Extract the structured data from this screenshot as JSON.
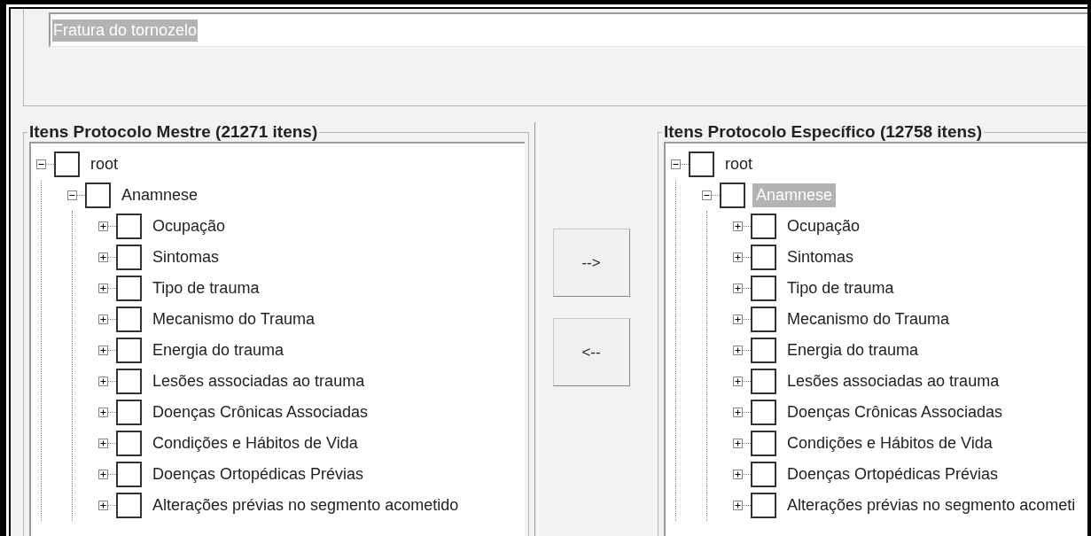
{
  "name_field": {
    "value": "Fratura do tornozelo",
    "text_selected": true
  },
  "left_panel": {
    "title": "Itens Protocolo Mestre (21271 itens)",
    "tree": [
      {
        "label": "root",
        "expanded": true,
        "checked": false,
        "selected": false,
        "children": [
          {
            "label": "Anamnese",
            "expanded": true,
            "checked": false,
            "selected": false,
            "children": [
              {
                "label": "Ocupação",
                "expanded": false,
                "checked": false,
                "selected": false
              },
              {
                "label": "Sintomas",
                "expanded": false,
                "checked": false,
                "selected": false
              },
              {
                "label": "Tipo de trauma",
                "expanded": false,
                "checked": false,
                "selected": false
              },
              {
                "label": "Mecanismo do Trauma",
                "expanded": false,
                "checked": false,
                "selected": false
              },
              {
                "label": "Energia do trauma",
                "expanded": false,
                "checked": false,
                "selected": false
              },
              {
                "label": "Lesões associadas ao trauma",
                "expanded": false,
                "checked": false,
                "selected": false
              },
              {
                "label": "Doenças Crônicas Associadas",
                "expanded": false,
                "checked": false,
                "selected": false
              },
              {
                "label": "Condições e Hábitos de Vida",
                "expanded": false,
                "checked": false,
                "selected": false
              },
              {
                "label": "Doenças Ortopédicas Prévias",
                "expanded": false,
                "checked": false,
                "selected": false
              },
              {
                "label": "Alterações prévias no segmento acometido",
                "expanded": false,
                "checked": false,
                "selected": false
              }
            ]
          }
        ]
      }
    ]
  },
  "buttons": [
    {
      "label": "-->"
    },
    {
      "label": "<--"
    }
  ],
  "right_panel": {
    "title": "Itens Protocolo Específico (12758 itens)",
    "tree": [
      {
        "label": "root",
        "expanded": true,
        "checked": false,
        "selected": false,
        "children": [
          {
            "label": "Anamnese",
            "expanded": true,
            "checked": false,
            "selected": true,
            "children": [
              {
                "label": "Ocupação",
                "expanded": false,
                "checked": false,
                "selected": false
              },
              {
                "label": "Sintomas",
                "expanded": false,
                "checked": false,
                "selected": false
              },
              {
                "label": "Tipo de trauma",
                "expanded": false,
                "checked": false,
                "selected": false
              },
              {
                "label": "Mecanismo do Trauma",
                "expanded": false,
                "checked": false,
                "selected": false
              },
              {
                "label": "Energia do trauma",
                "expanded": false,
                "checked": false,
                "selected": false
              },
              {
                "label": "Lesões associadas ao trauma",
                "expanded": false,
                "checked": false,
                "selected": false
              },
              {
                "label": "Doenças Crônicas Associadas",
                "expanded": false,
                "checked": false,
                "selected": false
              },
              {
                "label": "Condições e Hábitos de Vida",
                "expanded": false,
                "checked": false,
                "selected": false
              },
              {
                "label": "Doenças Ortopédicas Prévias",
                "expanded": false,
                "checked": false,
                "selected": false
              },
              {
                "label": "Alterações prévias no segmento acometi",
                "expanded": false,
                "checked": false,
                "selected": false
              }
            ]
          }
        ]
      }
    ]
  }
}
